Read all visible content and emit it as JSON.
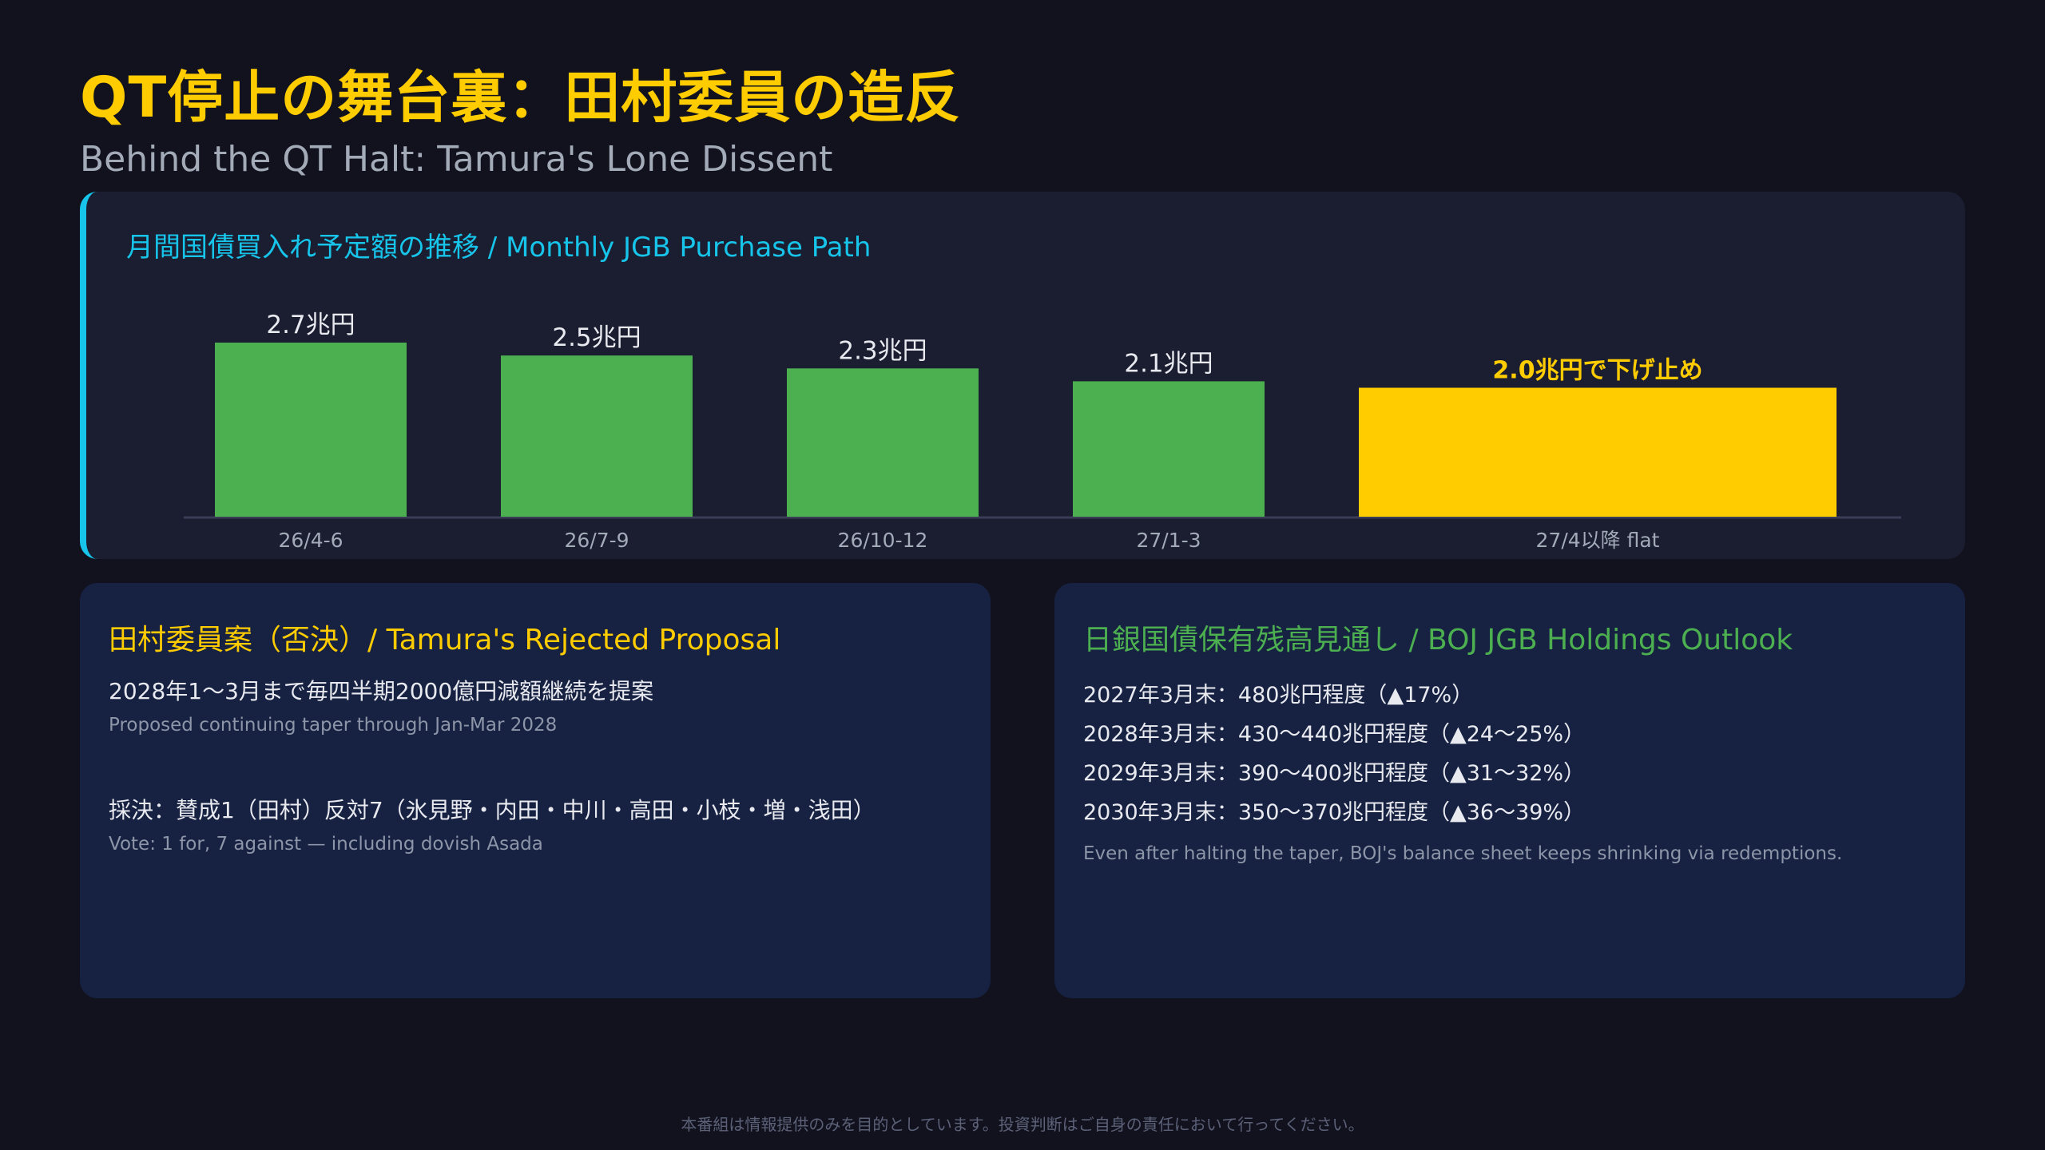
{
  "header": {
    "title": "QT停止の舞台裏：田村委員の造反",
    "subtitle": "Behind the QT Halt: Tamura's Lone Dissent"
  },
  "chart_panel": {
    "title": "月間国債買入れ予定額の推移 / Monthly JGB Purchase Path"
  },
  "chart_data": {
    "type": "bar",
    "categories": [
      "26/4-6",
      "26/7-9",
      "26/10-12",
      "27/1-3",
      "27/4以降 flat"
    ],
    "values": [
      2.7,
      2.5,
      2.3,
      2.1,
      2.0
    ],
    "data_labels": [
      "2.7兆円",
      "2.5兆円",
      "2.3兆円",
      "2.1兆円",
      "2.0兆円で下げ止め"
    ],
    "unit": "兆円",
    "ylim": [
      0,
      2.7
    ],
    "grid": false,
    "colors": {
      "normal": "#4caf50",
      "highlight": "#ffcc00",
      "label_normal": "#e8eaf0",
      "label_highlight": "#ffcc00",
      "axis": "#3a3d58",
      "tick": "#a3aab8"
    },
    "highlight_index": 4
  },
  "left_card": {
    "title": "田村委員案（否決）/ Tamura's Rejected Proposal",
    "proposal_jp": "2028年1〜3月まで毎四半期2000億円減額継続を提案",
    "proposal_en": "Proposed continuing taper through Jan-Mar 2028",
    "vote_jp": "採決：賛成1（田村）反対7（氷見野・内田・中川・高田・小枝・増・浅田）",
    "vote_en": "Vote: 1 for, 7 against — including dovish Asada"
  },
  "right_card": {
    "title": "日銀国債保有残高見通し / BOJ JGB Holdings Outlook",
    "lines": [
      "2027年3月末：480兆円程度（▲17%）",
      "2028年3月末：430〜440兆円程度（▲24〜25%）",
      "2029年3月末：390〜400兆円程度（▲31〜32%）",
      "2030年3月末：350〜370兆円程度（▲36〜39%）"
    ],
    "note": "Even after halting the taper, BOJ's balance sheet keeps shrinking via redemptions."
  },
  "footer": {
    "disclaimer": "本番組は情報提供のみを目的としています。投資判断はご自身の責任において行ってください。"
  }
}
